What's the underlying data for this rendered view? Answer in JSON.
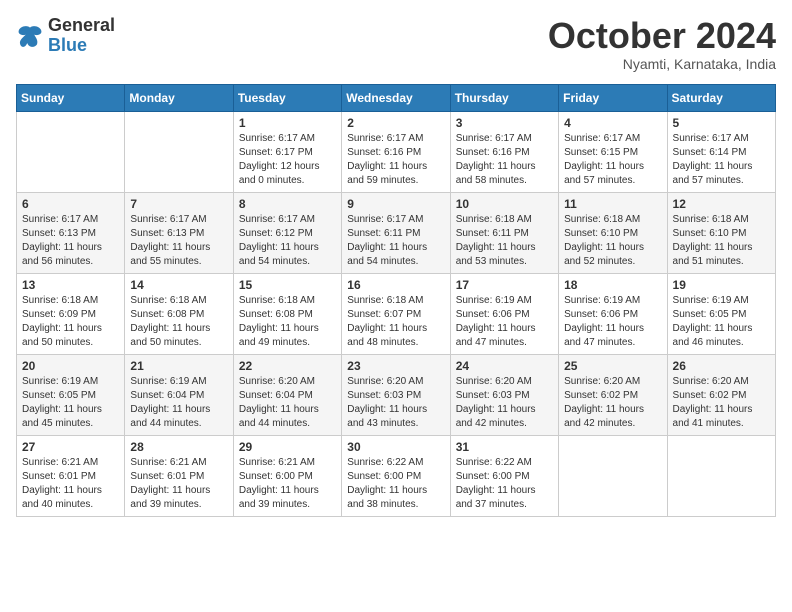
{
  "header": {
    "logo_text_general": "General",
    "logo_text_blue": "Blue",
    "month_title": "October 2024",
    "subtitle": "Nyamti, Karnataka, India"
  },
  "days_of_week": [
    "Sunday",
    "Monday",
    "Tuesday",
    "Wednesday",
    "Thursday",
    "Friday",
    "Saturday"
  ],
  "weeks": [
    [
      {
        "day": "",
        "info": ""
      },
      {
        "day": "",
        "info": ""
      },
      {
        "day": "1",
        "sunrise": "Sunrise: 6:17 AM",
        "sunset": "Sunset: 6:17 PM",
        "daylight": "Daylight: 12 hours and 0 minutes."
      },
      {
        "day": "2",
        "sunrise": "Sunrise: 6:17 AM",
        "sunset": "Sunset: 6:16 PM",
        "daylight": "Daylight: 11 hours and 59 minutes."
      },
      {
        "day": "3",
        "sunrise": "Sunrise: 6:17 AM",
        "sunset": "Sunset: 6:16 PM",
        "daylight": "Daylight: 11 hours and 58 minutes."
      },
      {
        "day": "4",
        "sunrise": "Sunrise: 6:17 AM",
        "sunset": "Sunset: 6:15 PM",
        "daylight": "Daylight: 11 hours and 57 minutes."
      },
      {
        "day": "5",
        "sunrise": "Sunrise: 6:17 AM",
        "sunset": "Sunset: 6:14 PM",
        "daylight": "Daylight: 11 hours and 57 minutes."
      }
    ],
    [
      {
        "day": "6",
        "sunrise": "Sunrise: 6:17 AM",
        "sunset": "Sunset: 6:13 PM",
        "daylight": "Daylight: 11 hours and 56 minutes."
      },
      {
        "day": "7",
        "sunrise": "Sunrise: 6:17 AM",
        "sunset": "Sunset: 6:13 PM",
        "daylight": "Daylight: 11 hours and 55 minutes."
      },
      {
        "day": "8",
        "sunrise": "Sunrise: 6:17 AM",
        "sunset": "Sunset: 6:12 PM",
        "daylight": "Daylight: 11 hours and 54 minutes."
      },
      {
        "day": "9",
        "sunrise": "Sunrise: 6:17 AM",
        "sunset": "Sunset: 6:11 PM",
        "daylight": "Daylight: 11 hours and 54 minutes."
      },
      {
        "day": "10",
        "sunrise": "Sunrise: 6:18 AM",
        "sunset": "Sunset: 6:11 PM",
        "daylight": "Daylight: 11 hours and 53 minutes."
      },
      {
        "day": "11",
        "sunrise": "Sunrise: 6:18 AM",
        "sunset": "Sunset: 6:10 PM",
        "daylight": "Daylight: 11 hours and 52 minutes."
      },
      {
        "day": "12",
        "sunrise": "Sunrise: 6:18 AM",
        "sunset": "Sunset: 6:10 PM",
        "daylight": "Daylight: 11 hours and 51 minutes."
      }
    ],
    [
      {
        "day": "13",
        "sunrise": "Sunrise: 6:18 AM",
        "sunset": "Sunset: 6:09 PM",
        "daylight": "Daylight: 11 hours and 50 minutes."
      },
      {
        "day": "14",
        "sunrise": "Sunrise: 6:18 AM",
        "sunset": "Sunset: 6:08 PM",
        "daylight": "Daylight: 11 hours and 50 minutes."
      },
      {
        "day": "15",
        "sunrise": "Sunrise: 6:18 AM",
        "sunset": "Sunset: 6:08 PM",
        "daylight": "Daylight: 11 hours and 49 minutes."
      },
      {
        "day": "16",
        "sunrise": "Sunrise: 6:18 AM",
        "sunset": "Sunset: 6:07 PM",
        "daylight": "Daylight: 11 hours and 48 minutes."
      },
      {
        "day": "17",
        "sunrise": "Sunrise: 6:19 AM",
        "sunset": "Sunset: 6:06 PM",
        "daylight": "Daylight: 11 hours and 47 minutes."
      },
      {
        "day": "18",
        "sunrise": "Sunrise: 6:19 AM",
        "sunset": "Sunset: 6:06 PM",
        "daylight": "Daylight: 11 hours and 47 minutes."
      },
      {
        "day": "19",
        "sunrise": "Sunrise: 6:19 AM",
        "sunset": "Sunset: 6:05 PM",
        "daylight": "Daylight: 11 hours and 46 minutes."
      }
    ],
    [
      {
        "day": "20",
        "sunrise": "Sunrise: 6:19 AM",
        "sunset": "Sunset: 6:05 PM",
        "daylight": "Daylight: 11 hours and 45 minutes."
      },
      {
        "day": "21",
        "sunrise": "Sunrise: 6:19 AM",
        "sunset": "Sunset: 6:04 PM",
        "daylight": "Daylight: 11 hours and 44 minutes."
      },
      {
        "day": "22",
        "sunrise": "Sunrise: 6:20 AM",
        "sunset": "Sunset: 6:04 PM",
        "daylight": "Daylight: 11 hours and 44 minutes."
      },
      {
        "day": "23",
        "sunrise": "Sunrise: 6:20 AM",
        "sunset": "Sunset: 6:03 PM",
        "daylight": "Daylight: 11 hours and 43 minutes."
      },
      {
        "day": "24",
        "sunrise": "Sunrise: 6:20 AM",
        "sunset": "Sunset: 6:03 PM",
        "daylight": "Daylight: 11 hours and 42 minutes."
      },
      {
        "day": "25",
        "sunrise": "Sunrise: 6:20 AM",
        "sunset": "Sunset: 6:02 PM",
        "daylight": "Daylight: 11 hours and 42 minutes."
      },
      {
        "day": "26",
        "sunrise": "Sunrise: 6:20 AM",
        "sunset": "Sunset: 6:02 PM",
        "daylight": "Daylight: 11 hours and 41 minutes."
      }
    ],
    [
      {
        "day": "27",
        "sunrise": "Sunrise: 6:21 AM",
        "sunset": "Sunset: 6:01 PM",
        "daylight": "Daylight: 11 hours and 40 minutes."
      },
      {
        "day": "28",
        "sunrise": "Sunrise: 6:21 AM",
        "sunset": "Sunset: 6:01 PM",
        "daylight": "Daylight: 11 hours and 39 minutes."
      },
      {
        "day": "29",
        "sunrise": "Sunrise: 6:21 AM",
        "sunset": "Sunset: 6:00 PM",
        "daylight": "Daylight: 11 hours and 39 minutes."
      },
      {
        "day": "30",
        "sunrise": "Sunrise: 6:22 AM",
        "sunset": "Sunset: 6:00 PM",
        "daylight": "Daylight: 11 hours and 38 minutes."
      },
      {
        "day": "31",
        "sunrise": "Sunrise: 6:22 AM",
        "sunset": "Sunset: 6:00 PM",
        "daylight": "Daylight: 11 hours and 37 minutes."
      },
      {
        "day": "",
        "info": ""
      },
      {
        "day": "",
        "info": ""
      }
    ]
  ]
}
